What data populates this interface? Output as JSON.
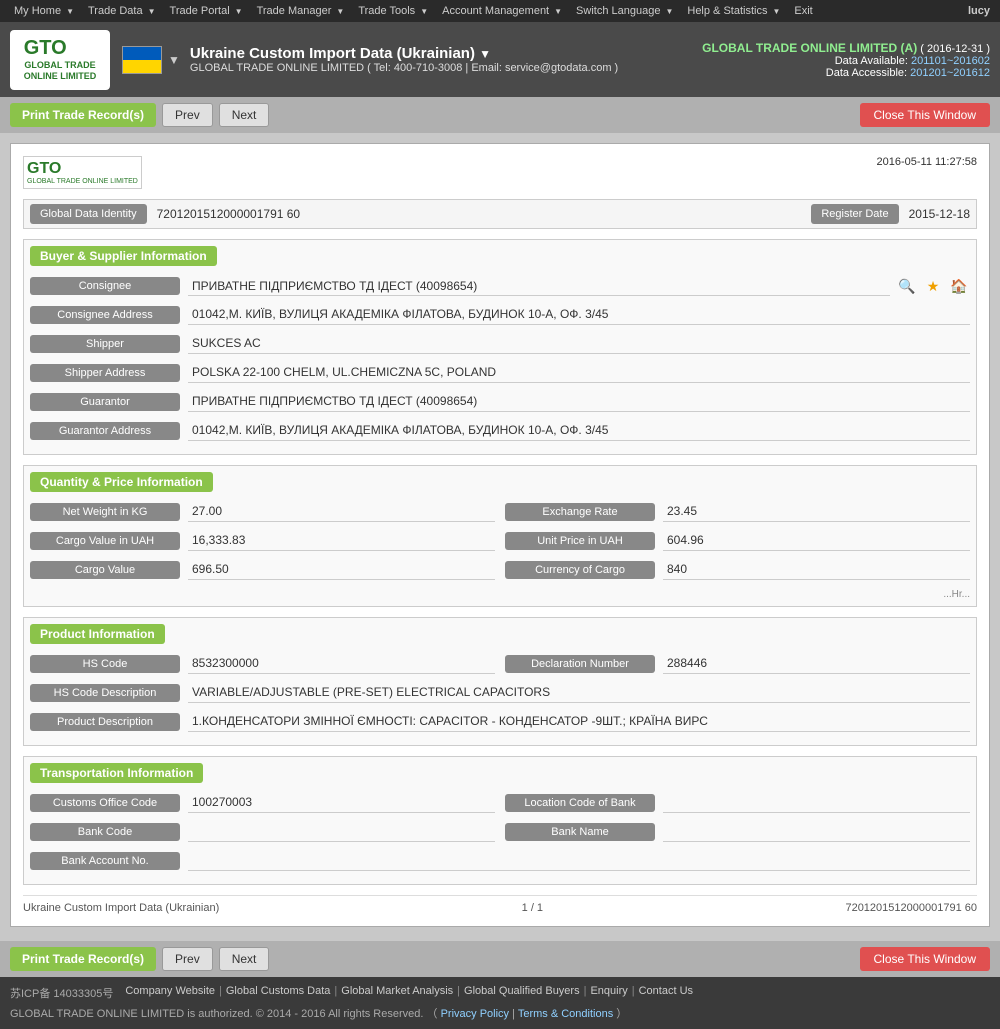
{
  "topnav": {
    "items": [
      {
        "label": "My Home",
        "id": "my-home"
      },
      {
        "label": "Trade Data",
        "id": "trade-data"
      },
      {
        "label": "Trade Portal",
        "id": "trade-portal"
      },
      {
        "label": "Trade Manager",
        "id": "trade-manager"
      },
      {
        "label": "Trade Tools",
        "id": "trade-tools"
      },
      {
        "label": "Account Management",
        "id": "account-management"
      },
      {
        "label": "Switch Language",
        "id": "switch-language"
      },
      {
        "label": "Help & Statistics",
        "id": "help-statistics"
      },
      {
        "label": "Exit",
        "id": "exit"
      }
    ],
    "user": "lucy"
  },
  "header": {
    "title": "Ukraine Custom Import Data (Ukrainian)",
    "subtitle": "GLOBAL TRADE ONLINE LIMITED ( Tel: 400-710-3008 | Email: service@gtodata.com )",
    "company": "GLOBAL TRADE ONLINE LIMITED (A)",
    "date": "( 2016-12-31 )",
    "data_available_label": "Data Available:",
    "data_available": "201101~201602",
    "data_accessible_label": "Data Accessible:",
    "data_accessible": "201201~201612"
  },
  "toolbar": {
    "print_label": "Print Trade Record(s)",
    "prev_label": "Prev",
    "next_label": "Next",
    "close_label": "Close This Window"
  },
  "record": {
    "timestamp": "2016-05-11 11:27:58",
    "global_data_identity_label": "Global Data Identity",
    "global_data_identity_value": "7201201512000001791 60",
    "register_date_label": "Register Date",
    "register_date_value": "2015-12-18"
  },
  "buyer_supplier": {
    "section_title": "Buyer & Supplier Information",
    "consignee_label": "Consignee",
    "consignee_value": "ПРИВАТНЕ ПІДПРИЄМСТВО ТД ІДЕСТ (40098654)",
    "consignee_address_label": "Consignee Address",
    "consignee_address_value": "01042,М. КИЇВ, ВУЛИЦЯ АКАДЕМІКА ФІЛАТОВА, БУДИНОК 10-А, ОФ. 3/45",
    "shipper_label": "Shipper",
    "shipper_value": "SUKCES AC",
    "shipper_address_label": "Shipper Address",
    "shipper_address_value": "POLSKA 22-100 CHELM, UL.CHEMICZNA 5C, POLAND",
    "guarantor_label": "Guarantor",
    "guarantor_value": "ПРИВАТНЕ ПІДПРИЄМСТВО ТД ІДЕСТ  (40098654)",
    "guarantor_address_label": "Guarantor Address",
    "guarantor_address_value": "01042,М. КИЇВ, ВУЛИЦЯ АКАДЕМІКА ФІЛАТОВА, БУДИНОК 10-А, ОФ. 3/45"
  },
  "quantity_price": {
    "section_title": "Quantity & Price Information",
    "net_weight_label": "Net Weight in KG",
    "net_weight_value": "27.00",
    "exchange_rate_label": "Exchange Rate",
    "exchange_rate_value": "23.45",
    "cargo_value_uah_label": "Cargo Value in UAH",
    "cargo_value_uah_value": "16,333.83",
    "unit_price_uah_label": "Unit Price in UAH",
    "unit_price_uah_value": "604.96",
    "cargo_value_label": "Cargo Value",
    "cargo_value_value": "696.50",
    "currency_of_cargo_label": "Currency of Cargo",
    "currency_of_cargo_value": "840",
    "currency_note": "...Hr..."
  },
  "product": {
    "section_title": "Product Information",
    "hs_code_label": "HS Code",
    "hs_code_value": "8532300000",
    "declaration_number_label": "Declaration Number",
    "declaration_number_value": "288446",
    "hs_code_description_label": "HS Code Description",
    "hs_code_description_value": "VARIABLE/ADJUSTABLE (PRE-SET) ELECTRICAL CAPACITORS",
    "product_description_label": "Product Description",
    "product_description_value": "1.КОНДЕНСАТОРИ ЗМІННОЇ ЄМНОСТІ: CAPACITOR - КОНДЕНСАТОР -9ШТ.; КРАЇНА ВИРС"
  },
  "transportation": {
    "section_title": "Transportation Information",
    "customs_office_code_label": "Customs Office Code",
    "customs_office_code_value": "100270003",
    "location_code_bank_label": "Location Code of Bank",
    "location_code_bank_value": "",
    "bank_code_label": "Bank Code",
    "bank_code_value": "",
    "bank_name_label": "Bank Name",
    "bank_name_value": "",
    "bank_account_label": "Bank Account No.",
    "bank_account_value": ""
  },
  "footer": {
    "record_title": "Ukraine Custom Import Data (Ukrainian)",
    "pagination": "1 / 1",
    "record_id": "7201201512000001791 60"
  },
  "bottom_footer": {
    "icp": "苏ICP备 14033305号",
    "links": [
      {
        "label": "Company Website"
      },
      {
        "label": "Global Customs Data"
      },
      {
        "label": "Global Market Analysis"
      },
      {
        "label": "Global Qualified Buyers"
      },
      {
        "label": "Enquiry"
      },
      {
        "label": "Contact Us"
      }
    ],
    "copyright": "GLOBAL TRADE ONLINE LIMITED is authorized. © 2014 - 2016 All rights Reserved.  （",
    "privacy": "Privacy Policy",
    "separator": "|",
    "terms": "Terms & Conditions",
    "closing": "）"
  }
}
